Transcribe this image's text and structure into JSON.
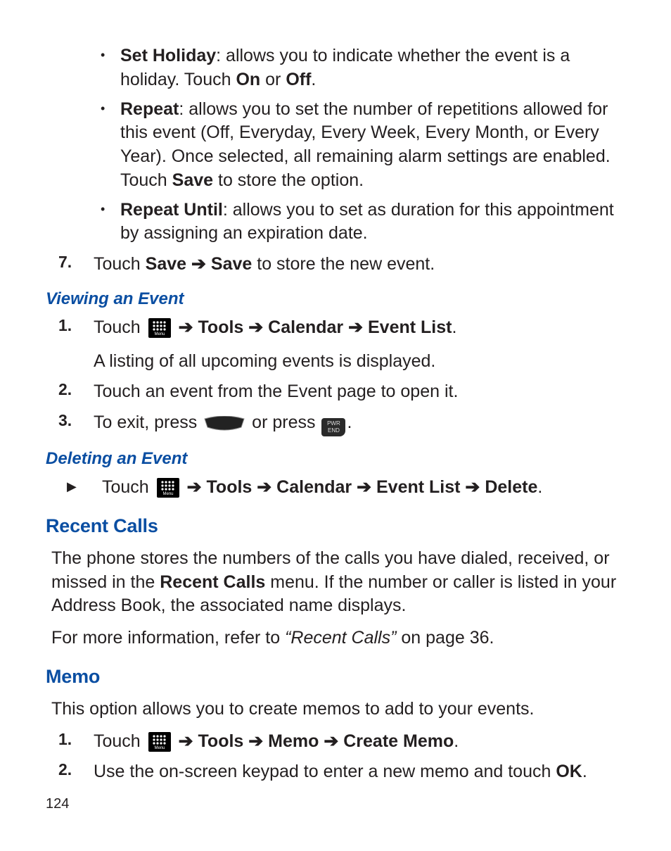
{
  "bullets": {
    "setHoliday": {
      "term": "Set Holiday",
      "text1": ": allows you to indicate whether the event is a holiday. Touch ",
      "on": "On",
      "or": " or ",
      "off": "Off",
      "period": "."
    },
    "repeat": {
      "term": "Repeat",
      "text1": ": allows you to set the number of repetitions allowed for this event (Off, Everyday, Every Week, Every Month, or Every Year). Once selected, all remaining alarm settings are enabled. Touch ",
      "save": "Save",
      "text2": " to store the option."
    },
    "repeatUntil": {
      "term": "Repeat Until",
      "text1": ": allows you to set as duration for this appointment by assigning an expiration date."
    }
  },
  "step7": {
    "num": "7.",
    "pre": "Touch ",
    "save1": "Save",
    "arrow": " ➔ ",
    "save2": "Save",
    "post": " to store the new event."
  },
  "viewing": {
    "heading": "Viewing an Event",
    "s1": {
      "num": "1.",
      "pre": "Touch  ",
      "a": " ➔ ",
      "t": "Tools",
      "c": "Calendar",
      "e": "Event List",
      "dot": ".",
      "after": "A listing of all upcoming events is displayed."
    },
    "s2": {
      "num": "2.",
      "txt": "Touch an event from the Event page to open it."
    },
    "s3": {
      "num": "3.",
      "pre": "To exit, press ",
      "mid": " or press ",
      "dot": "."
    }
  },
  "deleting": {
    "heading": "Deleting an Event",
    "row": {
      "pre": "Touch  ",
      "a": " ➔ ",
      "t": "Tools",
      "c": "Calendar",
      "e": "Event List",
      "d": "Delete",
      "dot": "."
    }
  },
  "recent": {
    "heading": "Recent Calls",
    "p1a": "The phone stores the numbers of the calls you have dialed, received, or missed in the ",
    "p1b": "Recent Calls",
    "p1c": " menu. If the number or caller is listed in your Address Book, the associated name displays.",
    "p2a": "For more information, refer to ",
    "p2b": "“Recent Calls”",
    "p2c": "  on page 36."
  },
  "memo": {
    "heading": "Memo",
    "intro": "This option allows you to create memos to add to your events.",
    "s1": {
      "num": "1.",
      "pre": "Touch  ",
      "a": " ➔ ",
      "t": "Tools",
      "m": "Memo",
      "c": "Create Memo",
      "dot": "."
    },
    "s2": {
      "num": "2.",
      "pre": "Use the on-screen keypad to enter a new memo and touch ",
      "ok": "OK",
      "dot": "."
    }
  },
  "icons": {
    "menuLabel": "Menu",
    "endTop": "PWR",
    "endBot": "END"
  },
  "page": "124"
}
